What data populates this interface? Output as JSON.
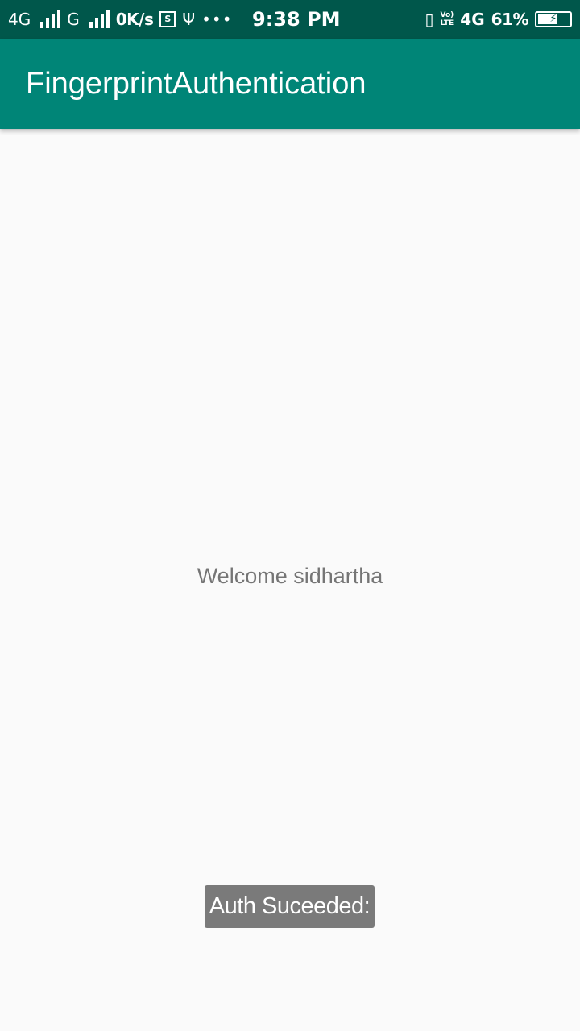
{
  "status_bar": {
    "left": {
      "network_primary": "4G",
      "network_secondary": "G",
      "speed": "0K/s",
      "sim_icon": "S",
      "icons": [
        "signal-icon",
        "signal-icon",
        "sim-card-icon",
        "usb-icon",
        "more-dots-icon"
      ]
    },
    "time": "9:38 PM",
    "right": {
      "volte_top": "Vo)",
      "volte_bottom": "LTE",
      "network_4g": "4G",
      "battery_percent": "61%",
      "battery_level": 0.61,
      "icons": [
        "vibrate-icon",
        "volte-icon",
        "4g-icon",
        "battery-charging-icon"
      ]
    }
  },
  "app_bar": {
    "title": "FingerprintAuthentication",
    "color": "#008577",
    "status_color": "#00574b"
  },
  "content": {
    "welcome_text": "Welcome sidhartha"
  },
  "toast": {
    "message": "Auth Suceeded:"
  }
}
